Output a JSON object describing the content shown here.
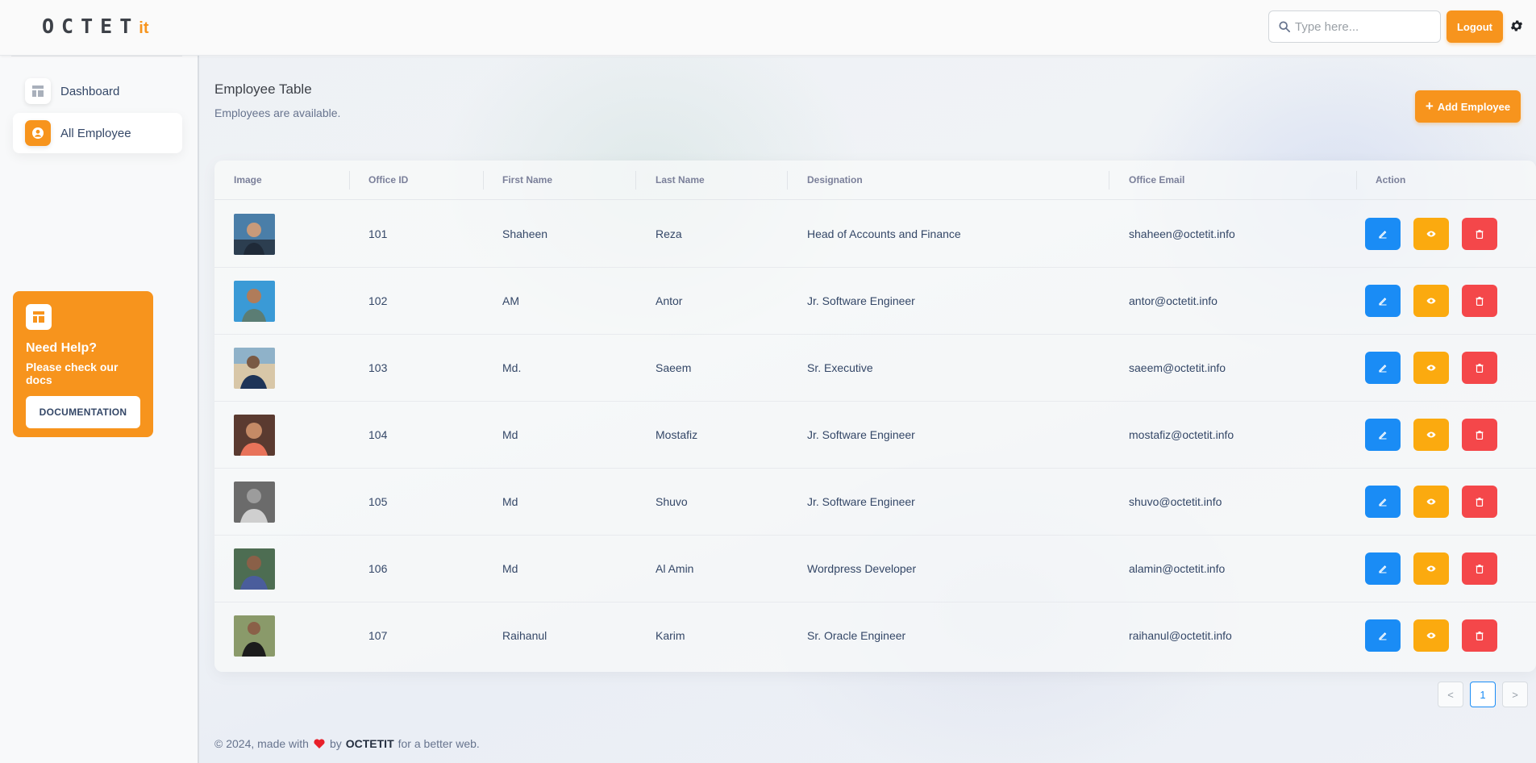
{
  "header": {
    "logo_main": "OCTET",
    "logo_suffix": "it",
    "search_placeholder": "Type here...",
    "logout_label": "Logout"
  },
  "sidebar": {
    "items": [
      {
        "label": "Dashboard",
        "icon": "dashboard-icon",
        "active": false
      },
      {
        "label": "All Employee",
        "icon": "user-circle-icon",
        "active": true
      }
    ],
    "help": {
      "title": "Need Help?",
      "subtitle": "Please check our docs",
      "button_label": "DOCUMENTATION"
    }
  },
  "main": {
    "title": "Employee Table",
    "subtitle": "Employees are available.",
    "add_button_label": "Add Employee"
  },
  "table": {
    "columns": [
      "Image",
      "Office ID",
      "First Name",
      "Last Name",
      "Designation",
      "Office Email",
      "Action"
    ],
    "rows": [
      {
        "office_id": "101",
        "first_name": "Shaheen",
        "last_name": "Reza",
        "designation": "Head of Accounts and Finance",
        "email": "shaheen@octetit.info"
      },
      {
        "office_id": "102",
        "first_name": "AM",
        "last_name": "Antor",
        "designation": "Jr. Software Engineer",
        "email": "antor@octetit.info"
      },
      {
        "office_id": "103",
        "first_name": "Md.",
        "last_name": "Saeem",
        "designation": "Sr. Executive",
        "email": "saeem@octetit.info"
      },
      {
        "office_id": "104",
        "first_name": "Md",
        "last_name": "Mostafiz",
        "designation": "Jr. Software Engineer",
        "email": "mostafiz@octetit.info"
      },
      {
        "office_id": "105",
        "first_name": "Md",
        "last_name": "Shuvo",
        "designation": "Jr. Software Engineer",
        "email": "shuvo@octetit.info"
      },
      {
        "office_id": "106",
        "first_name": "Md",
        "last_name": "Al Amin",
        "designation": "Wordpress Developer",
        "email": "alamin@octetit.info"
      },
      {
        "office_id": "107",
        "first_name": "Raihanul",
        "last_name": "Karim",
        "designation": "Sr. Oracle Engineer",
        "email": "raihanul@octetit.info"
      }
    ]
  },
  "pagination": {
    "prev": "<",
    "current": "1",
    "next": ">"
  },
  "footer": {
    "prefix": "© 2024, made with",
    "by": "by",
    "brand": "OCTETIT",
    "suffix": "for a better web."
  },
  "colors": {
    "brand_orange": "#f7941d",
    "edit_blue": "#1a8cf5",
    "view_amber": "#fbaa0f",
    "delete_red": "#f4474a"
  }
}
